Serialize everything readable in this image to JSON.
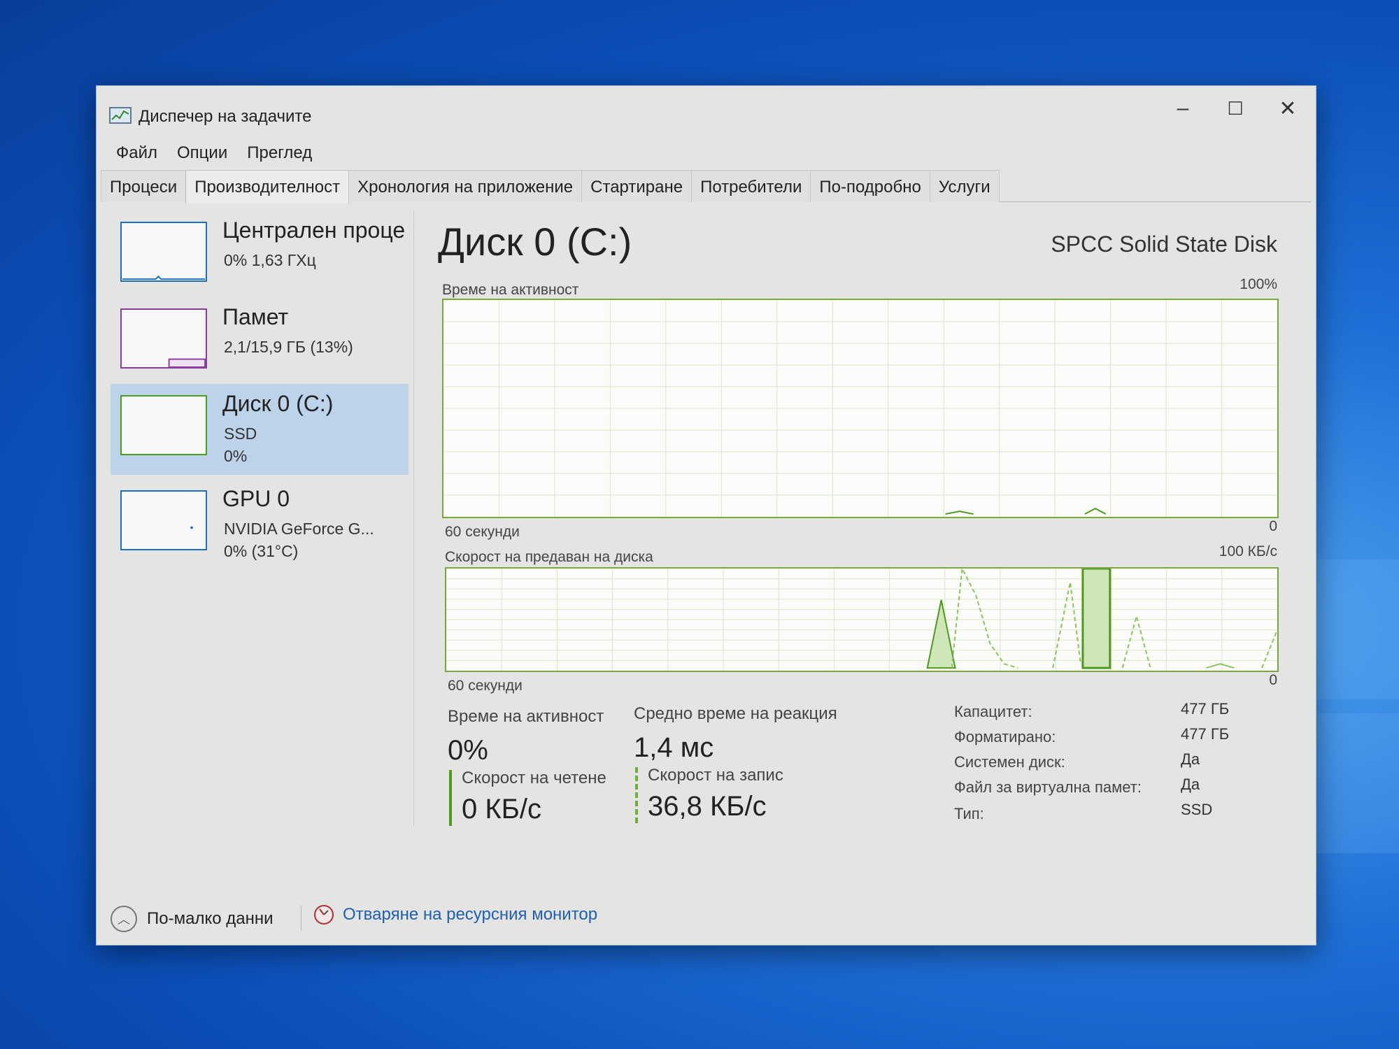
{
  "window": {
    "title": "Диспечер на задачите",
    "controls": {
      "minimize": "–",
      "maximize": "☐",
      "close": "✕"
    }
  },
  "menu": [
    "Файл",
    "Опции",
    "Преглед"
  ],
  "tabs": [
    {
      "label": "Процеси",
      "active": false
    },
    {
      "label": "Производителност",
      "active": true
    },
    {
      "label": "Хронология на приложение",
      "active": false
    },
    {
      "label": "Стартиране",
      "active": false
    },
    {
      "label": "Потребители",
      "active": false
    },
    {
      "label": "По-подробно",
      "active": false
    },
    {
      "label": "Услуги",
      "active": false
    }
  ],
  "sidebar": [
    {
      "title": "Централен проце",
      "line1": "0% 1,63 ГХц",
      "line2": "",
      "color": "#1f6ebd",
      "selected": false
    },
    {
      "title": "Памет",
      "line1": "2,1/15,9 ГБ (13%)",
      "line2": "",
      "color": "#8b3a9e",
      "selected": false
    },
    {
      "title": "Диск 0 (C:)",
      "line1": "SSD",
      "line2": "0%",
      "color": "#4c9a1e",
      "selected": true
    },
    {
      "title": "GPU 0",
      "line1": "NVIDIA GeForce G...",
      "line2": "0% (31°C)",
      "color": "#1f6ebd",
      "selected": false
    }
  ],
  "main": {
    "title": "Диск 0 (C:)",
    "model": "SPCC Solid State Disk",
    "activity_graph": {
      "label": "Време на активност",
      "max_label": "100%",
      "min_label": "0",
      "time_label": "60 секунди"
    },
    "transfer_graph": {
      "label": "Скорост на предаван на диска",
      "max_label": "100 КБ/с",
      "min_label": "0",
      "time_label": "60 секунди"
    },
    "stats": {
      "active_time_label": "Време на активност",
      "active_time_value": "0%",
      "response_label": "Средно време на реакция",
      "response_value": "1,4 мс",
      "read_label": "Скорост на четене",
      "read_value": "0 КБ/с",
      "write_label": "Скорост на запис",
      "write_value": "36,8 КБ/с"
    },
    "properties": [
      {
        "key": "Капацитет:",
        "value": "477 ГБ"
      },
      {
        "key": "Форматирано:",
        "value": "477 ГБ"
      },
      {
        "key": "Системен диск:",
        "value": "Да"
      },
      {
        "key": "Файл за виртуална памет:",
        "value": "Да"
      },
      {
        "key": "Тип:",
        "value": "SSD"
      }
    ]
  },
  "footer": {
    "fewer_details": "По-малко данни",
    "resource_monitor": "Отваряне на ресурсния монитор"
  },
  "colors": {
    "disk_accent": "#4c9a1e",
    "link": "#1f5fb0",
    "selection": "#bcd3ea"
  }
}
